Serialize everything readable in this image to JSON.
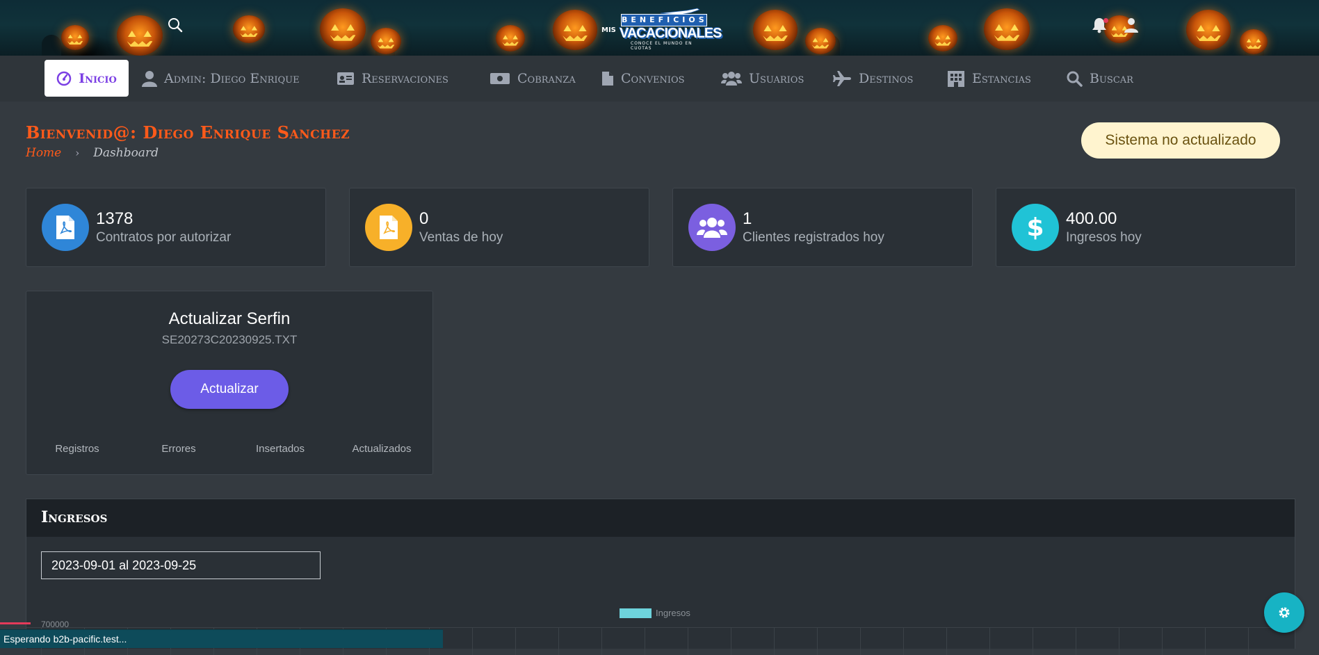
{
  "header": {
    "logo": {
      "line1": "BENEFICIOS",
      "prefix": "MIS",
      "line2": "VACACIONALES",
      "tagline": "CONOCE EL MUNDO EN CUOTAS"
    },
    "search_icon": "search-icon",
    "notification_icon": "bell-icon",
    "user_icon": "user-icon"
  },
  "nav": {
    "items": [
      {
        "label": "Inicio",
        "icon": "dashboard-icon",
        "active": true
      },
      {
        "label": "Admin: Diego Enrique",
        "icon": "user-icon"
      },
      {
        "label": "Reservaciones",
        "icon": "id-card-icon"
      },
      {
        "label": "Cobranza",
        "icon": "money-icon"
      },
      {
        "label": "Convenios",
        "icon": "file-icon"
      },
      {
        "label": "Usuarios",
        "icon": "users-icon"
      },
      {
        "label": "Destinos",
        "icon": "plane-icon"
      },
      {
        "label": "Estancias",
        "icon": "building-icon"
      },
      {
        "label": "Buscar",
        "icon": "search-icon"
      }
    ]
  },
  "page": {
    "welcome": "Bienvenid@: Diego Enrique Sanchez",
    "breadcrumb": {
      "home": "Home",
      "current": "Dashboard"
    },
    "system_status": "Sistema no actualizado"
  },
  "stats": [
    {
      "value": "1378",
      "label": "Contratos por autorizar",
      "icon": "file-pdf-icon",
      "color": "#2f86d8"
    },
    {
      "value": "0",
      "label": "Ventas de hoy",
      "icon": "file-pdf-icon",
      "color": "#f7b029"
    },
    {
      "value": "1",
      "label": "Clientes registrados hoy",
      "icon": "users-icon",
      "color": "#7b5fe0"
    },
    {
      "value": "400.00",
      "label": "Ingresos hoy",
      "icon": "dollar-icon",
      "color": "#20c3d6"
    }
  ],
  "update_panel": {
    "title": "Actualizar Serfin",
    "filename": "SE20273C20230925.TXT",
    "button": "Actualizar",
    "columns": [
      "Registros",
      "Errores",
      "Insertados",
      "Actualizados"
    ]
  },
  "ingresos": {
    "title": "Ingresos",
    "date_range": "2023-09-01 al 2023-09-25",
    "chart_data": {
      "type": "bar",
      "series": [
        {
          "name": "Ingresos",
          "values": []
        }
      ],
      "y_ticks": [
        "700000"
      ],
      "legend_color": "#6ed3dc"
    }
  },
  "status_bar": "Esperando b2b-pacific.test...",
  "settings_icon": "gear-icon"
}
